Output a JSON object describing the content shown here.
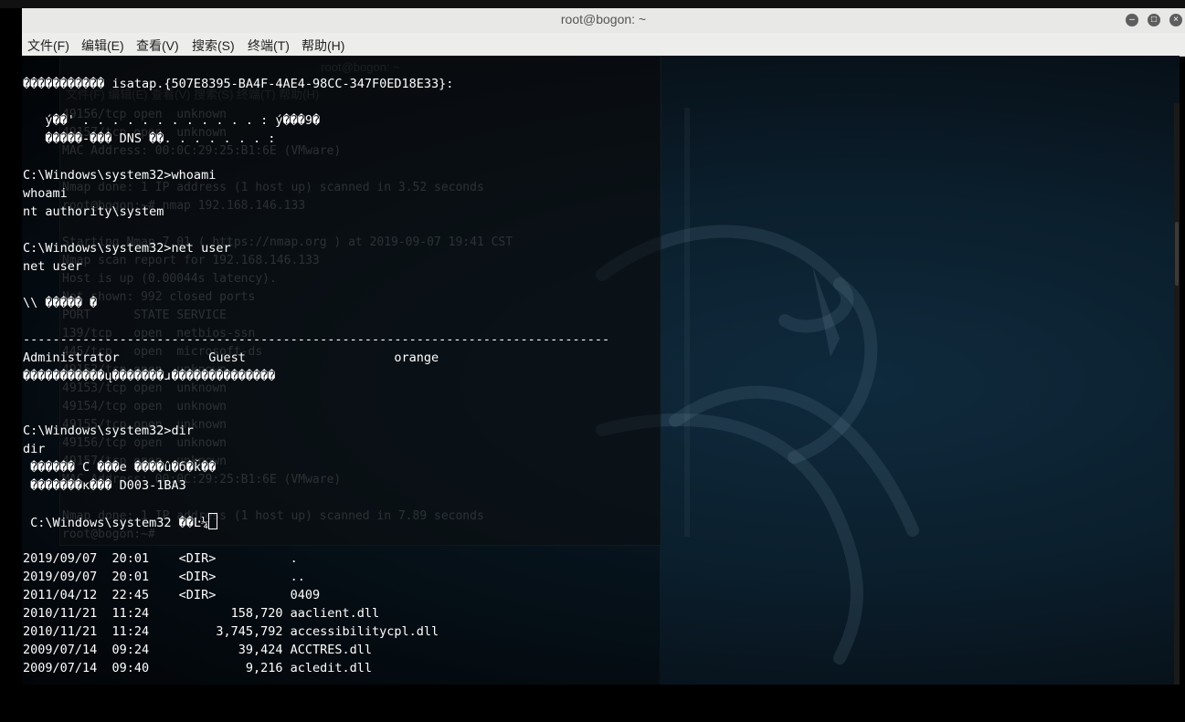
{
  "window": {
    "title": "root@bogon: ~",
    "minimize_icon": "minimize-icon",
    "maximize_icon": "maximize-icon",
    "close_icon": "close-icon"
  },
  "menu": {
    "items": [
      "文件(F)",
      "编辑(E)",
      "查看(V)",
      "搜索(S)",
      "终端(T)",
      "帮助(H)"
    ]
  },
  "ghost": {
    "title": "root@bogon: ~",
    "menu": "文件(F)  编辑(E)  查看(V)  搜索(S)  终端(T)  帮助(H)",
    "lines": [
      "49156/tcp open  unknown",
      "49157/tcp open  unknown",
      "MAC Address: 00:0C:29:25:B1:6E (VMware)",
      "",
      "Nmap done: 1 IP address (1 host up) scanned in 3.52 seconds",
      "root@bogon:~# nmap 192.168.146.133",
      "",
      "Starting Nmap 7.01 ( https://nmap.org ) at 2019-09-07 19:41 CST",
      "Nmap scan report for 192.168.146.133",
      "Host is up (0.00044s latency).",
      "Not shown: 992 closed ports",
      "PORT      STATE SERVICE",
      "139/tcp   open  netbios-ssn",
      "445/tcp   open  microsoft-ds",
      "49152/tcp open  unknown",
      "49153/tcp open  unknown",
      "49154/tcp open  unknown",
      "49155/tcp open  unknown",
      "49156/tcp open  unknown",
      "49157/tcp open  unknown",
      "MAC Address: 00:0C:29:25:B1:6E (VMware)",
      "",
      "Nmap done: 1 IP address (1 host up) scanned in 7.89 seconds",
      "root@bogon:~# "
    ]
  },
  "terminal": {
    "lines": [
      "����������� isatap.{507E8395-BA4F-4AE4-98CC-347F0ED18E33}:",
      "",
      "   ý��' . . . . . . . . . . . . : ý���9�",
      "   �����-��� DNS ��׺. . . . . . . :",
      "",
      "C:\\Windows\\system32>whoami",
      "whoami",
      "nt authority\\system",
      "",
      "C:\\Windows\\system32>net user",
      "net user",
      "",
      "\\\\ ����� �",
      "",
      "-------------------------------------------------------------------------------",
      "Administrator            Guest                    orange",
      "�����������ų�������ɹ��������������",
      "",
      "",
      "C:\\Windows\\system32>dir",
      "dir",
      " ������ C ���е ����û�б�ǩ��",
      " �������к��� D003-1BA3",
      "",
      " C:\\Windows\\system32 ��Ŀ¼",
      "",
      "2019/09/07  20:01    <DIR>          .",
      "2019/09/07  20:01    <DIR>          ..",
      "2011/04/12  22:45    <DIR>          0409",
      "2010/11/21  11:24           158,720 aaclient.dll",
      "2010/11/21  11:24         3,745,792 accessibilitycpl.dll",
      "2009/07/14  09:24            39,424 ACCTRES.dll",
      "2009/07/14  09:40             9,216 acledit.dll"
    ]
  },
  "colors": {
    "titlebar": "#e8e8e7",
    "menubar": "#ededec",
    "terminal_text": "#ffffff",
    "background_accent": "#0f2a3d"
  }
}
